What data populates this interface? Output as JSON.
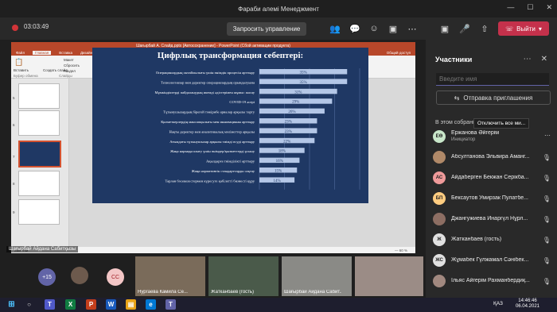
{
  "window": {
    "title": "Фараби алемі Менеджмент"
  },
  "toolbar": {
    "timer": "03:03:49",
    "share_label": "Запросить управление",
    "leave_label": "Выйти"
  },
  "ppt": {
    "title": "Шағырбай А. Слайд.pptx [Автосохранение] - PowerPoint (Сбой активации продукта)",
    "tabs": [
      "Файл",
      "Главная",
      "Вставка",
      "Дизайн",
      "Переходы",
      "Анимация",
      "Слайд-шоу",
      "Рецензирование",
      "Вид",
      "EndNote X7",
      "Что вы хотите сделать?"
    ],
    "share": "Общий доступ",
    "ribbon": {
      "paste": "Вставить",
      "new_slide": "Создать слайд",
      "layout": "Макет",
      "reset": "Сбросить",
      "section": "Раздел",
      "clipboard": "Буфер обмена",
      "slides": "Слайды",
      "font": "Шрифт",
      "paragraph": "Абзац",
      "drawing": "Рисование",
      "edit": "Редактирование",
      "find": "Найти",
      "replace": "Заменить",
      "select": "Выделить",
      "arrange": "Упорядочить",
      "styles": "Экспресс-стили",
      "fill": "Заливка фигуры",
      "outline": "Контур фигуры",
      "effects": "Эффекты фигур"
    },
    "thumb_numbers": [
      "5",
      "6",
      "7",
      "8",
      "9"
    ],
    "status": "Заметки",
    "zoom": "— 60 %"
  },
  "slide": {
    "title": "Цифрлық трансформация себептері:"
  },
  "chart_data": {
    "type": "bar",
    "orientation": "horizontal",
    "categories": [
      "Операциялардың онтайлылығы үшін өнімдік процесін арттыру",
      "Технологиялар мен деректер операциялардың орындалуына",
      "Мұмкіндіктерді пайдаланудың икемді әдістерімен жұмыс жасау",
      "COVID-19 әсері",
      "Тұтынушылардың бірегей тәжірибе арналар арқылы тарту",
      "Қызметкерлердің мансапқылығы мен инновацияны арттыру",
      "Нақты деректер мен аналитикалық мәліметтер арқылы",
      "Ағымдағы тұтынушылар арқылы тиімді өсуді арттыру",
      "Жаңа нарыққа шығу үшін өнімдер/қызметтерді ұсыну",
      "Ақылдарға тиімділікті арттыру",
      "Жаңа нормативтік стандарттарды сақтау",
      "Тарлан бәсекелестермен күресуге қабілетті бизнесті құру"
    ],
    "values": [
      35,
      35,
      31,
      29,
      26,
      23,
      23,
      22,
      18,
      16,
      15,
      14
    ],
    "labels": [
      "35%",
      "35%",
      "31%",
      "29%",
      "26%",
      "23%",
      "23%",
      "22%",
      "18%",
      "16%",
      "15%",
      "14%"
    ],
    "xlim": [
      0,
      40
    ]
  },
  "presenter": {
    "name": "Шағырбай Айдана Сабитқызы"
  },
  "bottom": {
    "more": "+15",
    "initials": "CC",
    "tiles": [
      "Нургаева Камила Се...",
      "Жатканбаев (гость)",
      "Шағырбай Айдана Сабит...",
      ""
    ]
  },
  "panel": {
    "title": "Участники",
    "search_placeholder": "Введите имя",
    "invite": "Отправка приглашения",
    "section": "В этом собрании (21)",
    "mute_all": "Отключить все ми...",
    "participants": [
      {
        "initials": "ЕӨ",
        "name": "Ержанова Әйгерім",
        "role": "Инициатор",
        "color": "#c8e6c9"
      },
      {
        "initials": "",
        "name": "Абсултанова Эльвира Аманг...",
        "role": "",
        "color": "#b08968"
      },
      {
        "initials": "АС",
        "name": "Айдаберген Бекжан Серікба...",
        "role": "",
        "color": "#ef9a9a"
      },
      {
        "initials": "БП",
        "name": "Бексаутов Умирзак Пулатбе...",
        "role": "",
        "color": "#ffcc80"
      },
      {
        "initials": "",
        "name": "Джангужиева Инаргүл Нұрл...",
        "role": "",
        "color": "#8d6e63"
      },
      {
        "initials": "Ж",
        "name": "Жатканбаев (гость)",
        "role": "",
        "color": "#e0e0e0"
      },
      {
        "initials": "ЖС",
        "name": "Жұмабек Гүлжамал Сәнібек...",
        "role": "",
        "color": "#e0e0e0"
      },
      {
        "initials": "",
        "name": "Ільяс Айгерім Рахманбердиқ...",
        "role": "",
        "color": "#a1887f"
      }
    ]
  },
  "taskbar": {
    "lang": "ҚАЗ",
    "time": "14:46:46",
    "date": "06.04.2021"
  }
}
